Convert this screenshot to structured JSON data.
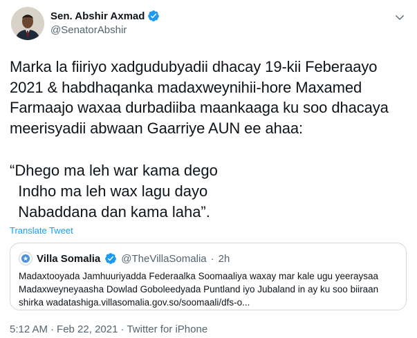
{
  "author": {
    "display_name": "Sen. Abshir Axmad",
    "handle": "@SenatorAbshir",
    "verified": true
  },
  "tweet": {
    "text": "Marka la fiiriyo xadgudubyadii dhacay 19-kii Feberaayo 2021 & habdhaqanka madaxweynihii-hore Maxamed Farmaajo waxaa durbadiiba maankaaga ku soo dhacaya meerisyadii abwaan Gaarriye AUN ee ahaa:",
    "poem_lines": [
      "“Dhego ma leh war kama dego",
      "  Indho ma leh wax lagu dayo",
      "  Nabaddana dan kama laha”."
    ],
    "translate_label": "Translate Tweet"
  },
  "quoted_tweet": {
    "display_name": "Villa Somalia",
    "handle": "@TheVillaSomalia",
    "separator": "·",
    "time": "2h",
    "verified": true,
    "text": "Madaxtooyada Jamhuuriyadda Federaalka Soomaaliya waxay mar kale ugu yeeraysaa Madaxweyneyaasha Dowlad Goboleedyada Puntland iyo Jubaland in ay ku soo biiraan shirka wadatashiga.villasomalia.gov.so/soomaali/dfs-o..."
  },
  "meta": {
    "time": "5:12 AM",
    "separator1": "·",
    "date": "Feb 22, 2021",
    "separator2": "·",
    "source": "Twitter for iPhone"
  },
  "colors": {
    "accent": "#1d9bf0",
    "secondary_text": "#536471",
    "border": "#cfd9de"
  },
  "icons": {
    "verified": "verified-badge-icon",
    "more": "chevron-down-icon",
    "quote_avatar": "coat-of-arms-icon"
  }
}
